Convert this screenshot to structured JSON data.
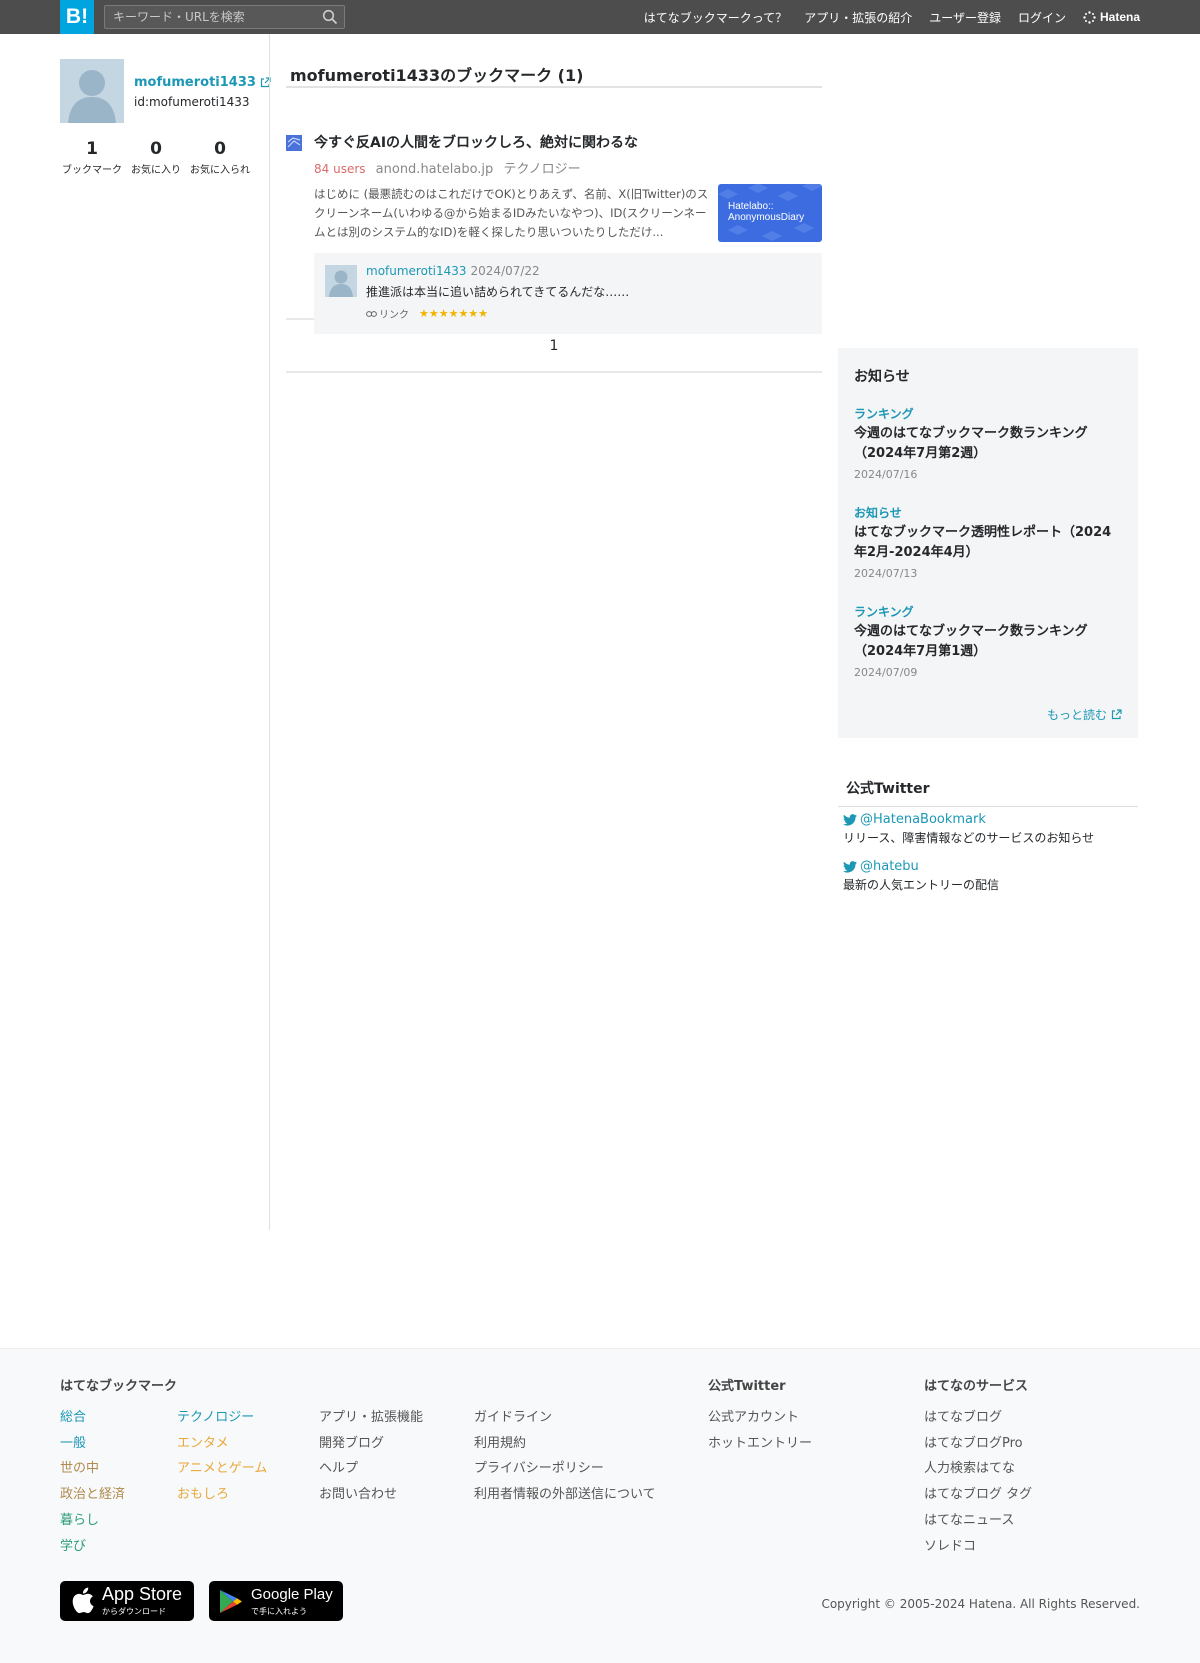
{
  "header": {
    "logo": "B!",
    "search_placeholder": "キーワード・URLを検索",
    "nav": [
      "はてなブックマークって？",
      "アプリ・拡張の紹介",
      "ユーザー登録",
      "ログイン"
    ],
    "brand": "Hatena"
  },
  "profile": {
    "username": "mofumeroti1433",
    "id": "id:mofumeroti1433",
    "stats": [
      {
        "n": "1",
        "label": "ブックマーク"
      },
      {
        "n": "0",
        "label": "お気に入り"
      },
      {
        "n": "0",
        "label": "お気に入られ"
      }
    ]
  },
  "main": {
    "title": "mofumeroti1433のブックマーク (1)",
    "entry": {
      "title": "今すぐ反AIの人間をブロックしろ、絶対に関わるな",
      "users": "84 users",
      "domain": "anond.hatelabo.jp",
      "category": "テクノロジー",
      "summary": "はじめに (最悪読むのはこれだけでOK)とりあえず、名前、X(旧Twitter)のスクリーンネーム(いわゆる@から始まるIDみたいなやつ)、ID(スクリーンネームとは別のシステム的なID)を軽く探したり思いついたりしただけ...",
      "thumb_text_1": "Hatelabo::",
      "thumb_text_2": "AnonymousDiary",
      "comment": {
        "user": "mofumeroti1433",
        "date": "2024/07/22",
        "text": "推進派は本当に追い詰められてきてるんだな……",
        "link": "リンク",
        "stars": "★★★★★★★"
      }
    },
    "pager": "1"
  },
  "news": {
    "heading": "お知らせ",
    "items": [
      {
        "cat": "ランキング",
        "title": "今週のはてなブックマーク数ランキング（2024年7月第2週）",
        "date": "2024/07/16"
      },
      {
        "cat": "お知らせ",
        "title": "はてなブックマーク透明性レポート（2024年2月-2024年4月）",
        "date": "2024/07/13"
      },
      {
        "cat": "ランキング",
        "title": "今週のはてなブックマーク数ランキング（2024年7月第1週）",
        "date": "2024/07/09"
      }
    ],
    "more": "もっと読む"
  },
  "twitter": {
    "heading": "公式Twitter",
    "accounts": [
      {
        "handle": "@HatenaBookmark",
        "desc": "リリース、障害情報などのサービスのお知らせ"
      },
      {
        "handle": "@hatebu",
        "desc": "最新の人気エントリーの配信"
      }
    ]
  },
  "footer": {
    "bookmark_heading": "はてなブックマーク",
    "cat_col1": [
      "総合",
      "一般",
      "世の中",
      "政治と経済",
      "暮らし",
      "学び"
    ],
    "cat_col2": [
      "テクノロジー",
      "エンタメ",
      "アニメとゲーム",
      "おもしろ"
    ],
    "links_col3": [
      "アプリ・拡張機能",
      "開発ブログ",
      "ヘルプ",
      "お問い合わせ"
    ],
    "links_col4": [
      "ガイドライン",
      "利用規約",
      "プライバシーポリシー",
      "利用者情報の外部送信について"
    ],
    "twitter_heading": "公式Twitter",
    "twitter_links": [
      "公式アカウント",
      "ホットエントリー"
    ],
    "services_heading": "はてなのサービス",
    "services": [
      "はてなブログ",
      "はてなブログPro",
      "人力検索はてな",
      "はてなブログ タグ",
      "はてなニュース",
      "ソレドコ"
    ],
    "appstore_big": "App Store",
    "appstore_small": "からダウンロード",
    "googleplay_big": "Google Play",
    "googleplay_small": "で手に入れよう",
    "copyright": "Copyright © 2005-2024 Hatena. All Rights Reserved."
  }
}
